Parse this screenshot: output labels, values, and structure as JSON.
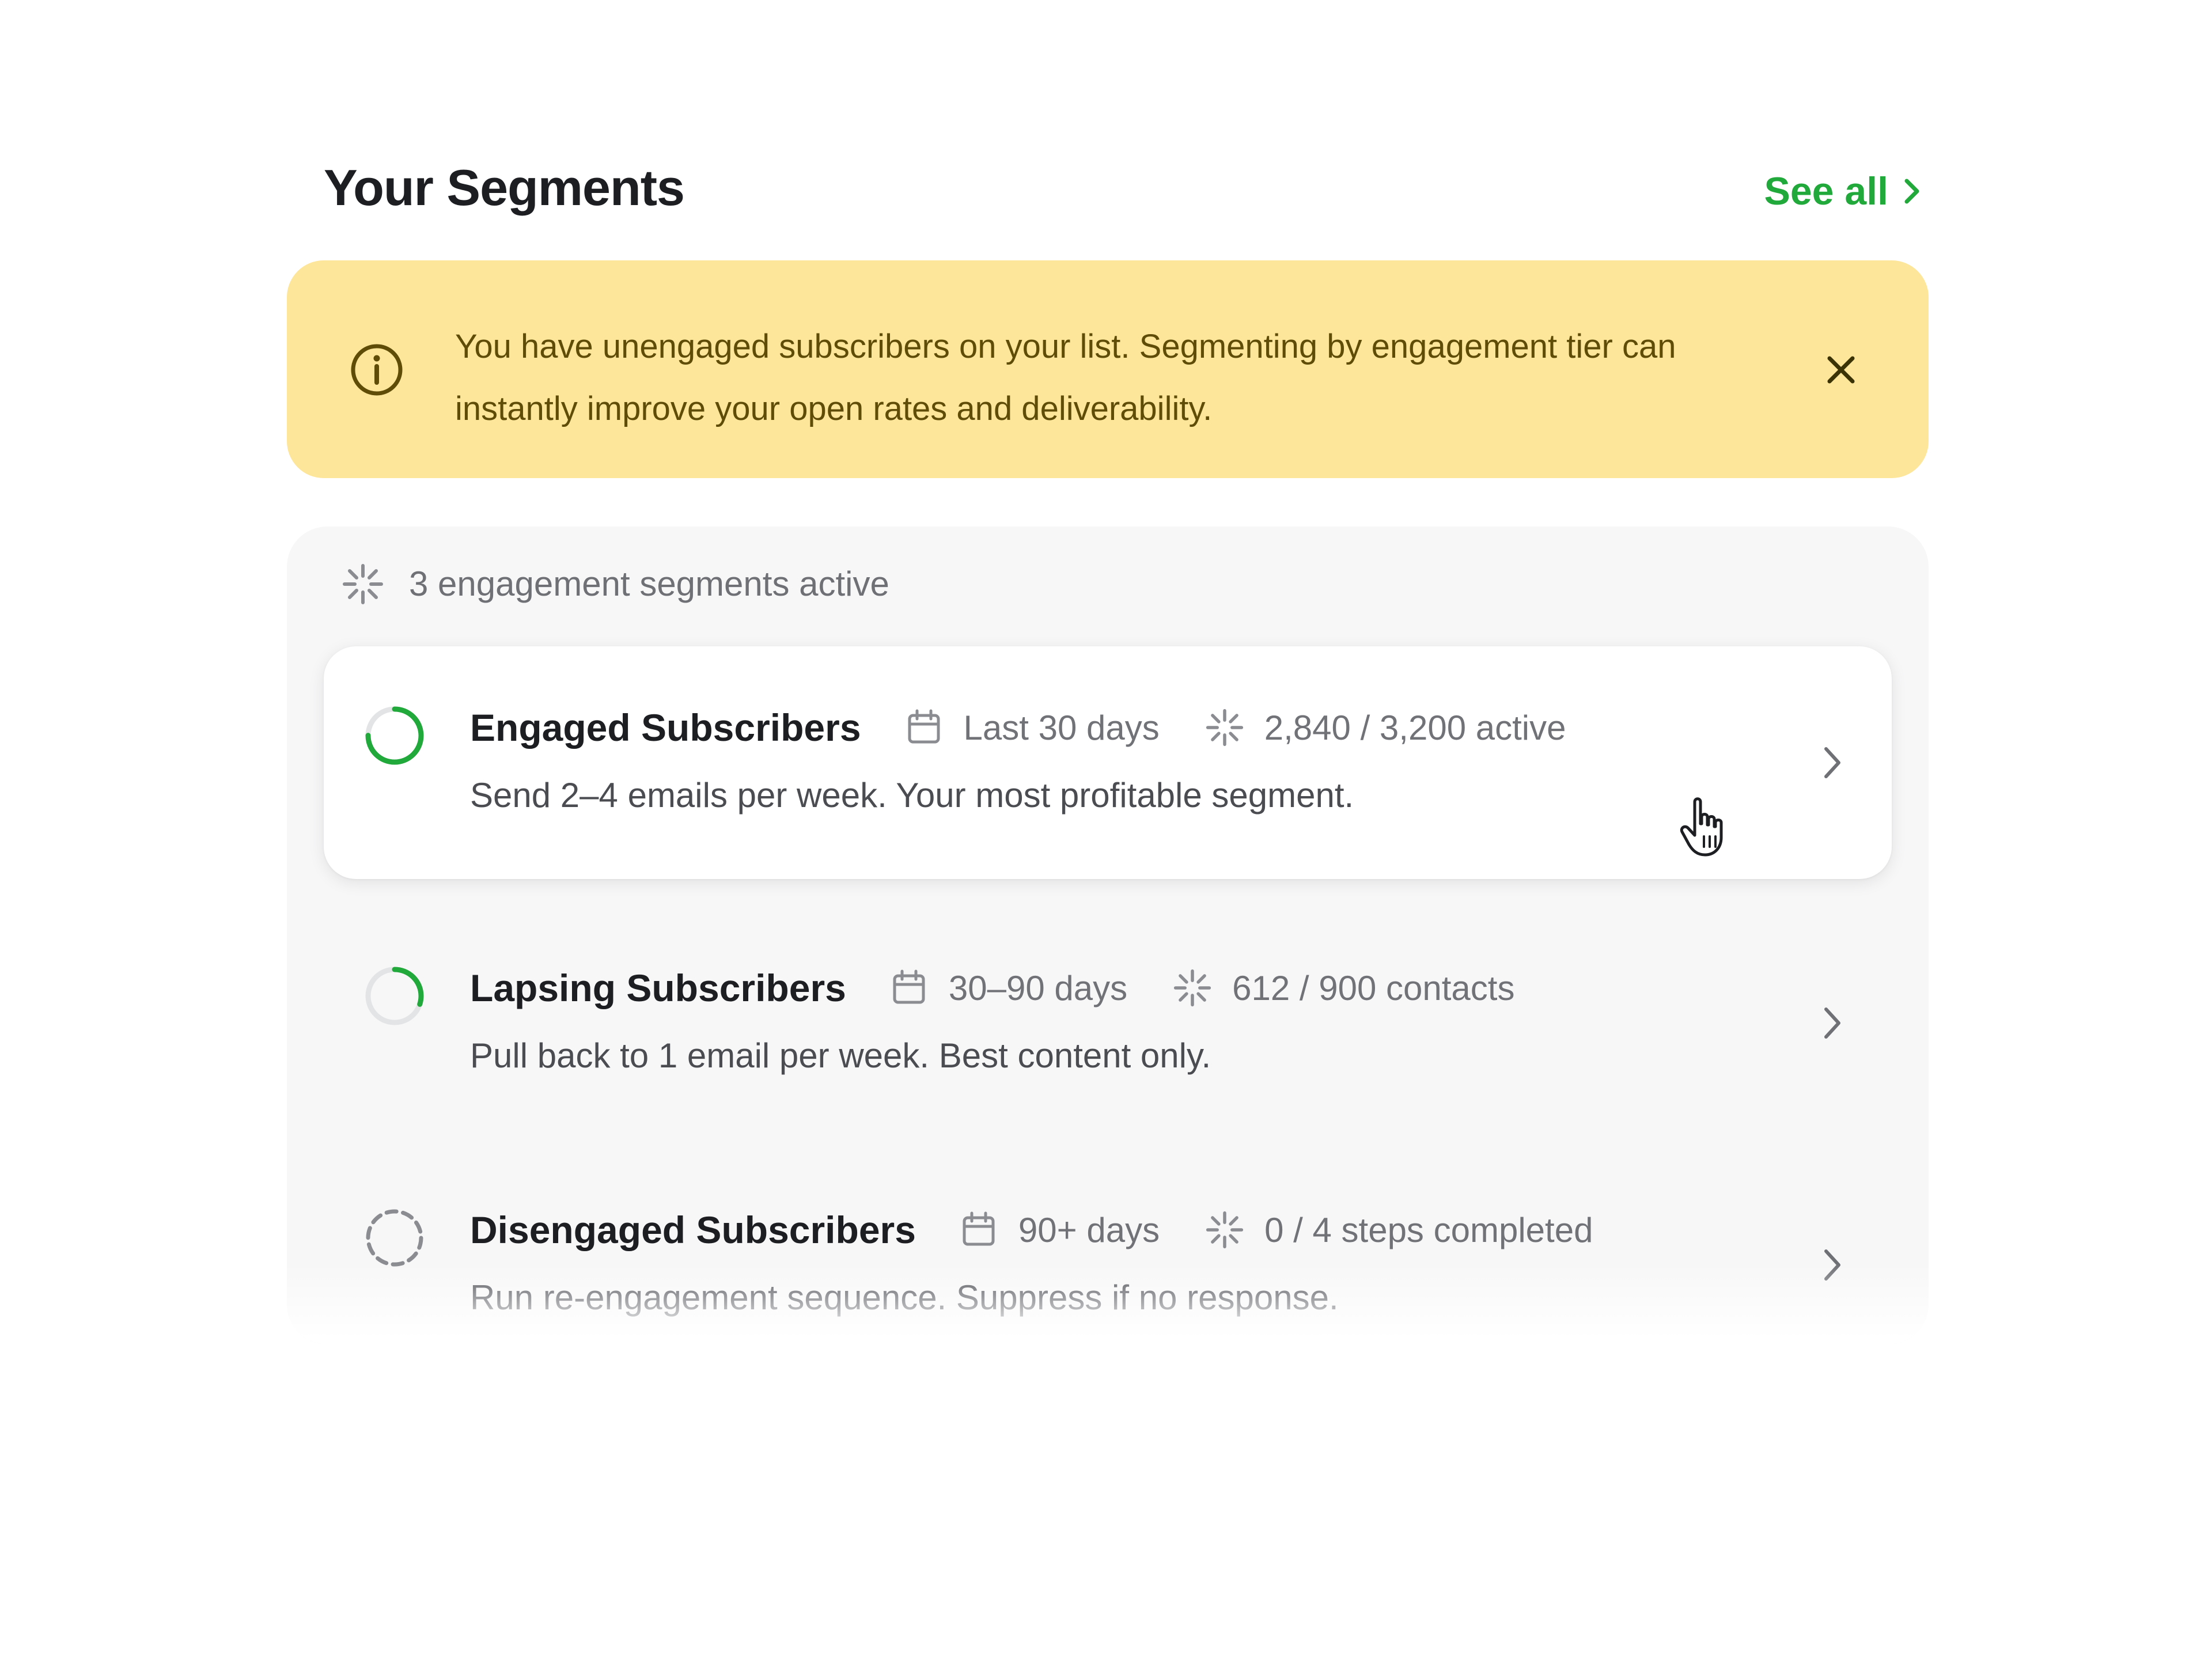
{
  "header": {
    "title": "Your Segments",
    "see_all_label": "See all",
    "accent_color": "#22a93c"
  },
  "banner": {
    "message": "You have unengaged subscribers on your list. Segmenting by engagement tier can instantly improve your open rates and deliverability.",
    "icon": "info-icon",
    "close_icon": "close-icon",
    "background_color": "#fde59a",
    "text_color": "#5e4c07"
  },
  "segments_panel": {
    "summary": "3 engagement segments active",
    "summary_icon": "sparkle-icon",
    "items": [
      {
        "name": "Engaged Subscribers",
        "period": "Last 30 days",
        "stat": "2,840 / 3,200 active",
        "description": "Send 2–4 emails per week. Your most profitable segment.",
        "progress_fraction": 0.75,
        "ring_style": "solid",
        "active": true
      },
      {
        "name": "Lapsing Subscribers",
        "period": "30–90 days",
        "stat": "612 / 900 contacts",
        "description": "Pull back to 1 email per week. Best content only.",
        "progress_fraction": 0.3,
        "ring_style": "solid",
        "active": false
      },
      {
        "name": "Disengaged Subscribers",
        "period": "90+ days",
        "stat": "0 / 4 steps completed",
        "description": "Run re-engagement sequence. Suppress if no response.",
        "progress_fraction": 0,
        "ring_style": "dashed",
        "active": false
      }
    ]
  }
}
